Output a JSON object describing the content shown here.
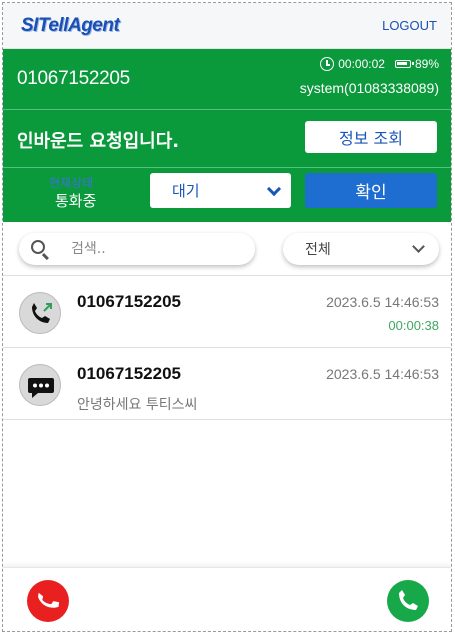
{
  "header": {
    "logo": "SITellAgent",
    "logout_label": "LOGOUT"
  },
  "call": {
    "phone": "01067152205",
    "timer": "00:00:02",
    "battery": "89%",
    "system": "system(01083338089)"
  },
  "notice": {
    "message": "인바운드 요청입니다.",
    "info_button": "정보 조회"
  },
  "status": {
    "label": "현재상태",
    "value": "통화중",
    "select_value": "대기",
    "confirm_button": "확인"
  },
  "search": {
    "placeholder": "검색..",
    "filter_value": "전체"
  },
  "list": [
    {
      "type": "call",
      "number": "01067152205",
      "datetime": "2023.6.5 14:46:53",
      "duration": "00:00:38"
    },
    {
      "type": "message",
      "number": "01067152205",
      "datetime": "2023.6.5 14:46:53",
      "message": "안녕하세요 투티스씨"
    }
  ],
  "colors": {
    "brand_green": "#0a9a3c",
    "brand_blue": "#1a55b8",
    "hangup_red": "#e82020",
    "answer_green": "#17a84a"
  },
  "icons": {
    "clock": "clock-icon",
    "battery": "battery-icon",
    "search": "search-icon",
    "outgoing_call": "outgoing-call-icon",
    "message": "message-icon",
    "hangup": "hangup-icon",
    "answer": "answer-icon"
  }
}
